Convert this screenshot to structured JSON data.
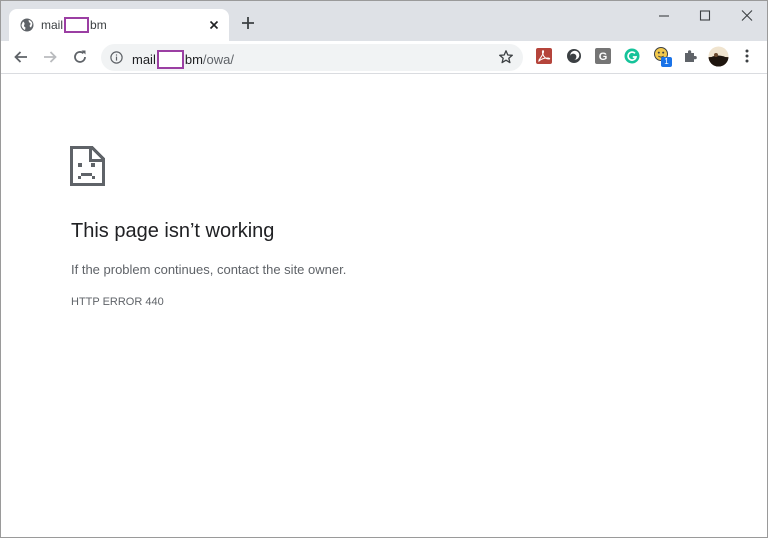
{
  "tab": {
    "title_prefix": "mail",
    "title_suffix": "bm",
    "favicon": "globe-icon"
  },
  "window_controls": [
    "minimize",
    "maximize",
    "close"
  ],
  "address_bar": {
    "url_prefix": "mail",
    "url_host_suffix": "bm",
    "url_path": "/owa/",
    "redaction_color": "#9b3fa3"
  },
  "toolbar_icons": [
    "back-icon",
    "forward-icon",
    "reload-icon",
    "site-info-icon",
    "bookmark-star-icon"
  ],
  "extensions": [
    "acrobat-icon",
    "dark-circle-icon",
    "g-extension-icon",
    "grammarly-icon",
    "notification-extension-icon",
    "puzzle-extensions-icon",
    "profile-avatar",
    "menu-kebab-icon"
  ],
  "extension_badge": "1",
  "error_page": {
    "icon": "sad-page-icon",
    "title": "This page isn’t working",
    "message": "If the problem continues, contact the site owner.",
    "code": "HTTP ERROR 440"
  }
}
